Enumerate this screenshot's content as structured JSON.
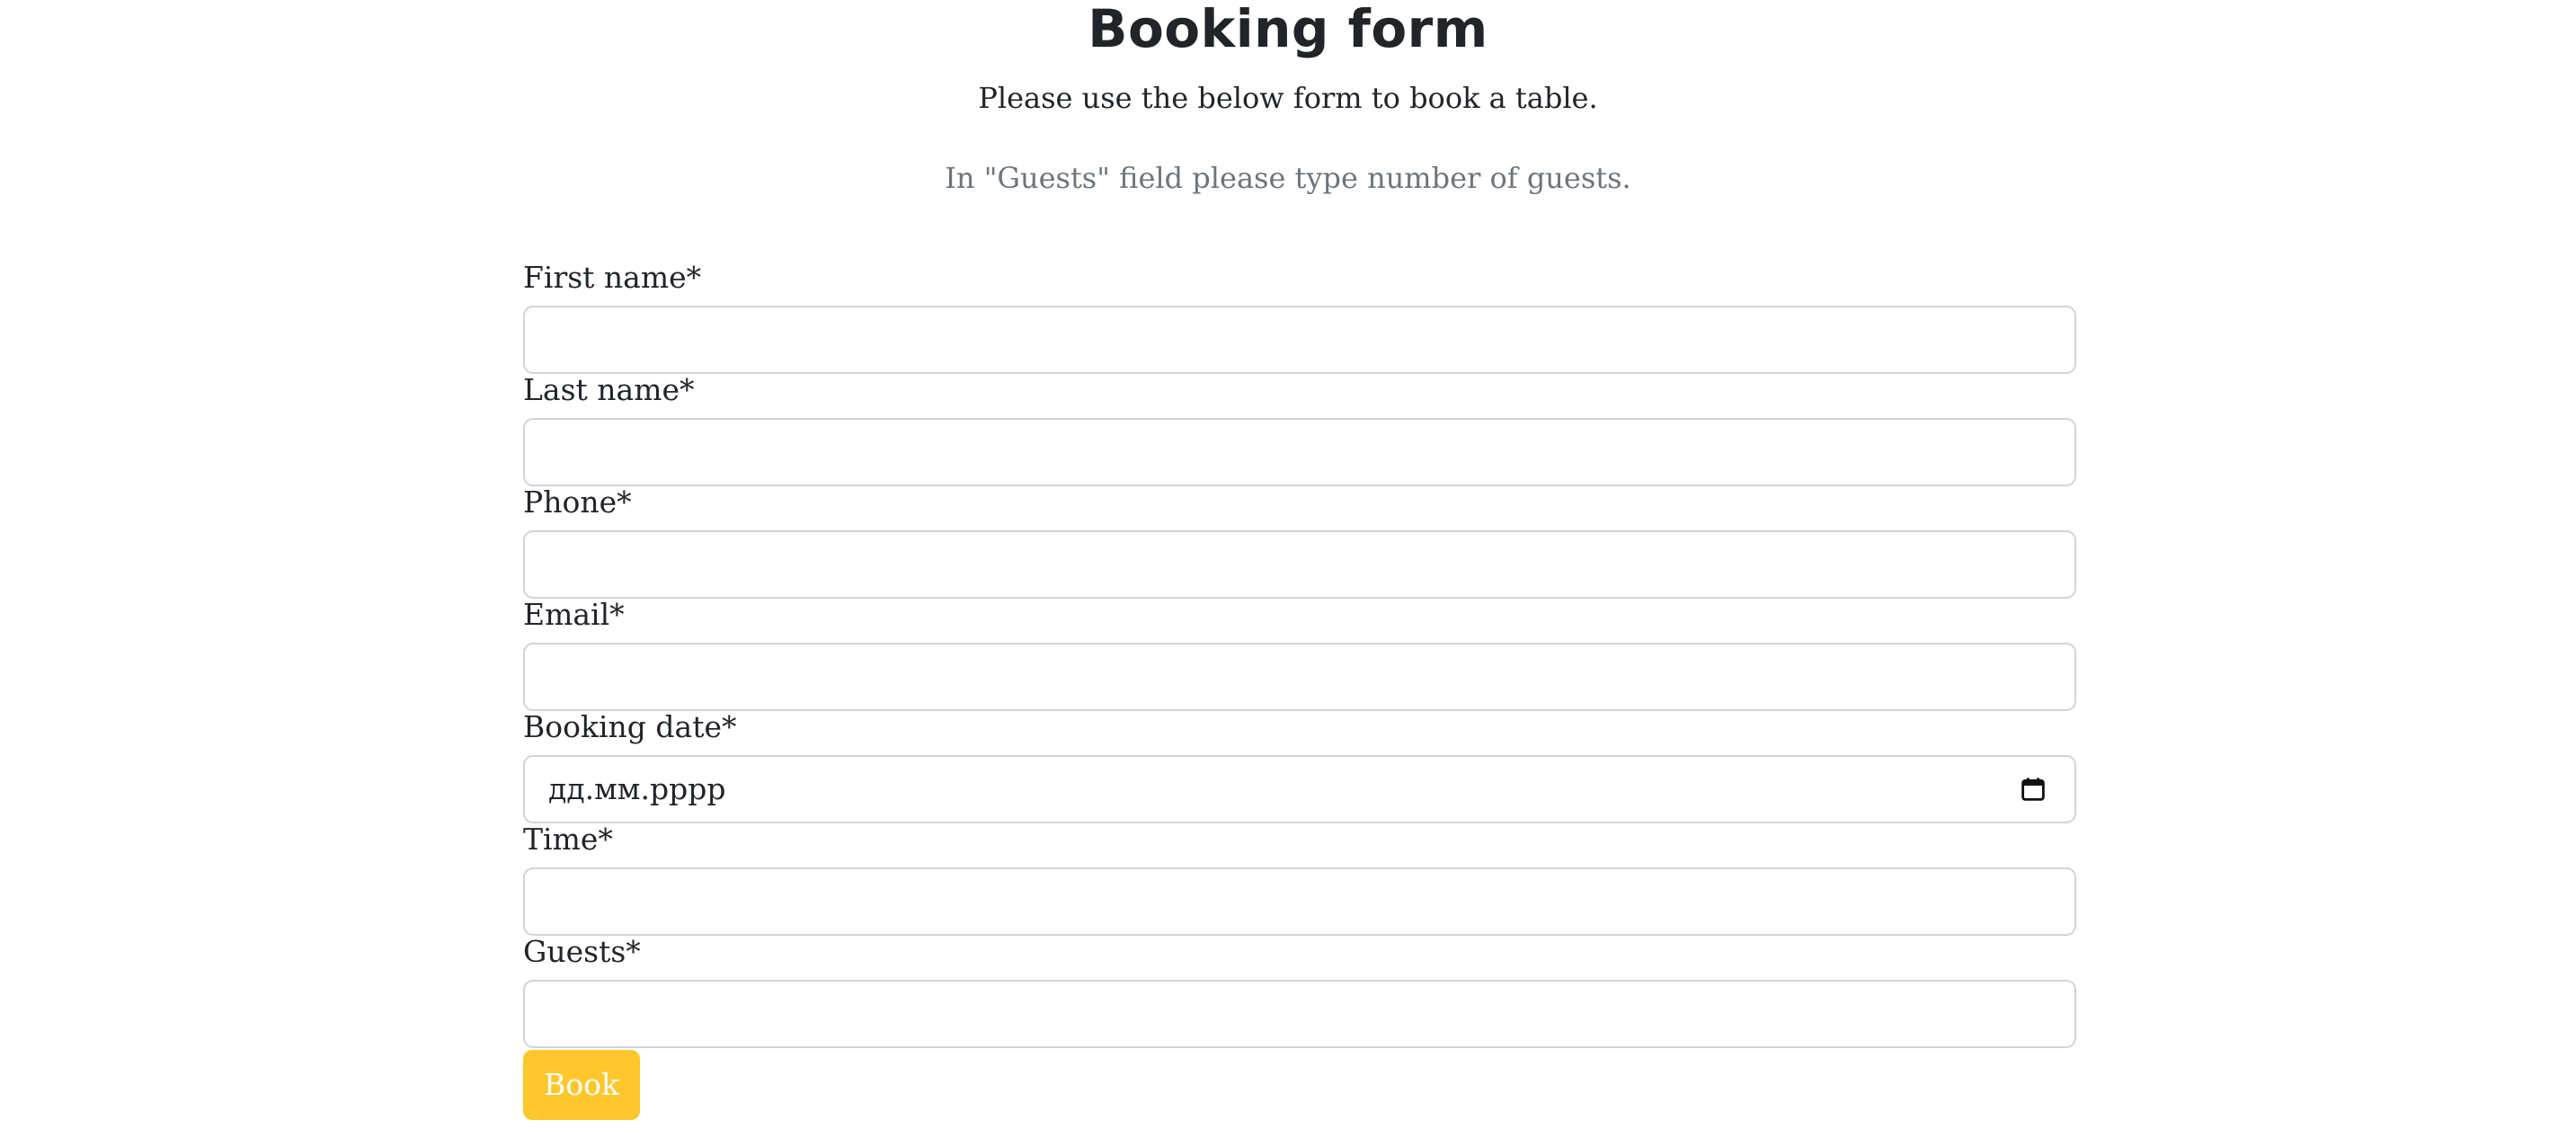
{
  "header": {
    "title": "Booking form",
    "subtitle": "Please use the below form to book a table.",
    "hint": "In \"Guests\" field please type number of guests."
  },
  "form": {
    "fields": [
      {
        "label": "First name*",
        "value": ""
      },
      {
        "label": "Last name*",
        "value": ""
      },
      {
        "label": "Phone*",
        "value": ""
      },
      {
        "label": "Email*",
        "value": ""
      },
      {
        "label": "Booking date*",
        "value": "дд.мм.рррр",
        "icon": "calendar-icon"
      },
      {
        "label": "Time*",
        "value": ""
      },
      {
        "label": "Guests*",
        "value": ""
      }
    ],
    "submit_label": "Book"
  },
  "colors": {
    "text": "#212529",
    "muted": "#6c757d",
    "border": "#ced4da",
    "button": "#ffc72c",
    "button_text": "#ffffff"
  }
}
